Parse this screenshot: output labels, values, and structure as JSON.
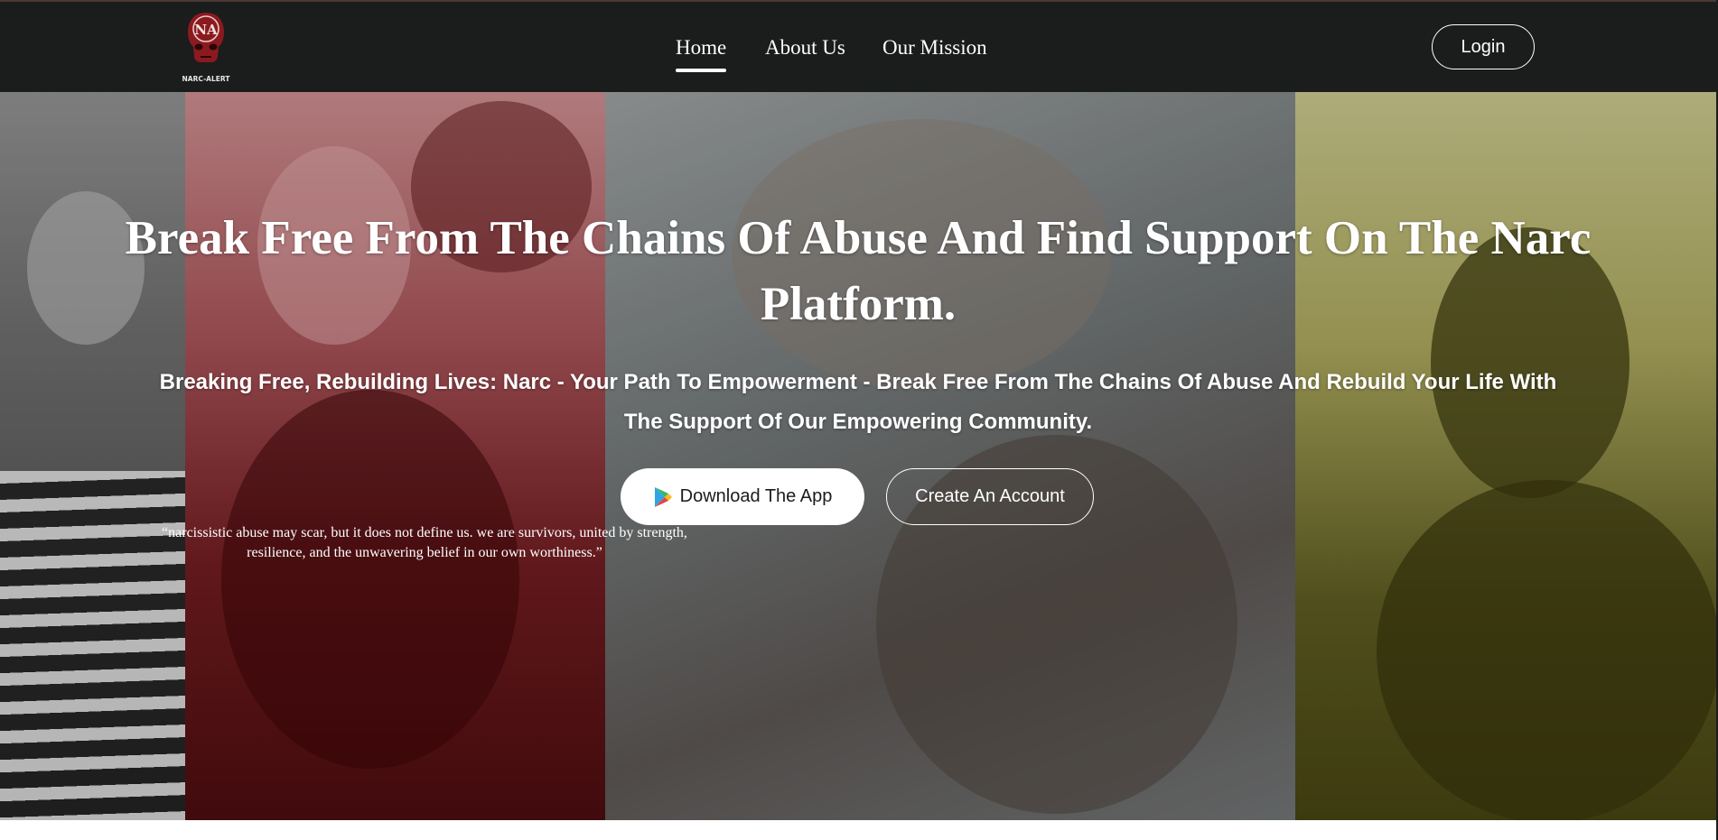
{
  "nav": {
    "logo_text": "NARC-ALERT",
    "logo_monogram": "NA",
    "links": [
      {
        "label": "Home",
        "active": true
      },
      {
        "label": "About Us",
        "active": false
      },
      {
        "label": "Our Mission",
        "active": false
      }
    ],
    "login_label": "Login"
  },
  "hero": {
    "title": "Break Free From The Chains Of Abuse And Find Support On The Narc Platform.",
    "subtitle": "Breaking Free, Rebuilding Lives: Narc - Your Path To Empowerment - Break Free From The Chains Of Abuse And Rebuild Your Life With The Support Of Our Empowering Community.",
    "download_label": "Download The App",
    "download_icon": "play-store-icon",
    "create_label": "Create An Account",
    "quote": "“narcissistic abuse may scar, but it does not define us. we are survivors, united by strength, resilience, and the unwavering belief in our own worthiness.”"
  },
  "colors": {
    "navbar": "#1b1c1c",
    "panel_gray": "#7a7a7a",
    "panel_red": "#8c2a2e",
    "panel_slate": "#6d7172",
    "panel_olive": "#a8a45c",
    "logo_red": "#8b1a1f"
  }
}
